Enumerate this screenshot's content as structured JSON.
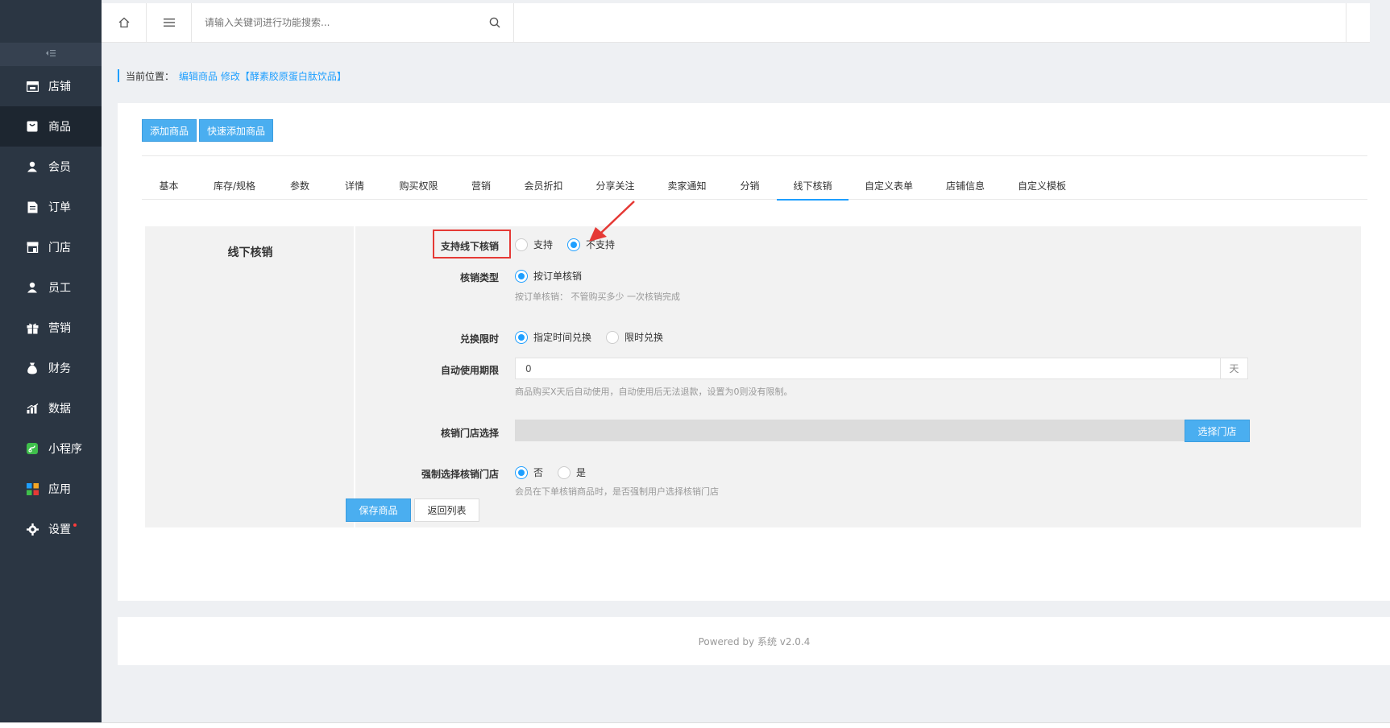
{
  "sidebar": {
    "collapse_icon": "collapse-icon",
    "items": [
      {
        "label": "店铺",
        "icon": "store-icon",
        "active": false
      },
      {
        "label": "商品",
        "icon": "goods-icon",
        "active": true
      },
      {
        "label": "会员",
        "icon": "member-icon",
        "active": false
      },
      {
        "label": "订单",
        "icon": "order-icon",
        "active": false
      },
      {
        "label": "门店",
        "icon": "shop-icon",
        "active": false
      },
      {
        "label": "员工",
        "icon": "staff-icon",
        "active": false
      },
      {
        "label": "营销",
        "icon": "gift-icon",
        "active": false
      },
      {
        "label": "财务",
        "icon": "finance-icon",
        "active": false
      },
      {
        "label": "数据",
        "icon": "chart-icon",
        "active": false
      },
      {
        "label": "小程序",
        "icon": "miniprogram-icon",
        "active": false
      },
      {
        "label": "应用",
        "icon": "apps-icon",
        "active": false
      },
      {
        "label": "设置",
        "icon": "gear-icon",
        "active": false
      }
    ]
  },
  "topbar": {
    "search_placeholder": "请输入关键词进行功能搜索..."
  },
  "breadcrumb": {
    "label": "当前位置：",
    "path": "编辑商品 修改【酵素胶原蛋白肽饮品】"
  },
  "actions": {
    "add_goods": "添加商品",
    "quick_add_goods": "快速添加商品"
  },
  "tabs": [
    {
      "label": "基本",
      "active": false
    },
    {
      "label": "库存/规格",
      "active": false
    },
    {
      "label": "参数",
      "active": false
    },
    {
      "label": "详情",
      "active": false
    },
    {
      "label": "购买权限",
      "active": false
    },
    {
      "label": "营销",
      "active": false
    },
    {
      "label": "会员折扣",
      "active": false
    },
    {
      "label": "分享关注",
      "active": false
    },
    {
      "label": "卖家通知",
      "active": false
    },
    {
      "label": "分销",
      "active": false
    },
    {
      "label": "线下核销",
      "active": true
    },
    {
      "label": "自定义表单",
      "active": false
    },
    {
      "label": "店铺信息",
      "active": false
    },
    {
      "label": "自定义模板",
      "active": false
    }
  ],
  "form": {
    "section_title": "线下核销",
    "support_offline": {
      "label": "支持线下核销",
      "options": [
        "支持",
        "不支持"
      ],
      "selected": "不支持"
    },
    "verify_type": {
      "label": "核销类型",
      "options": [
        "按订单核销"
      ],
      "selected": "按订单核销",
      "hint": "按订单核销： 不管购买多少 一次核销完成"
    },
    "redeem_limit": {
      "label": "兑换限时",
      "options": [
        "指定时间兑换",
        "限时兑换"
      ],
      "selected": "指定时间兑换"
    },
    "auto_use": {
      "label": "自动使用期限",
      "value": "0",
      "suffix": "天",
      "hint": "商品购买X天后自动使用，自动使用后无法退款，设置为0则没有限制。"
    },
    "store_select": {
      "label": "核销门店选择",
      "button": "选择门店"
    },
    "force_store": {
      "label": "强制选择核销门店",
      "options": [
        "否",
        "是"
      ],
      "selected": "否",
      "hint": "会员在下单核销商品时，是否强制用户选择核销门店"
    },
    "save_button": "保存商品",
    "back_button": "返回列表"
  },
  "footer": {
    "text": "Powered by 系统 v2.0.4"
  },
  "colors": {
    "sidebar_bg": "#2b3643",
    "sidebar_active": "#1d2630",
    "accent": "#1e9fff",
    "button_blue": "#4aaef0",
    "highlight_red": "#e53935"
  }
}
